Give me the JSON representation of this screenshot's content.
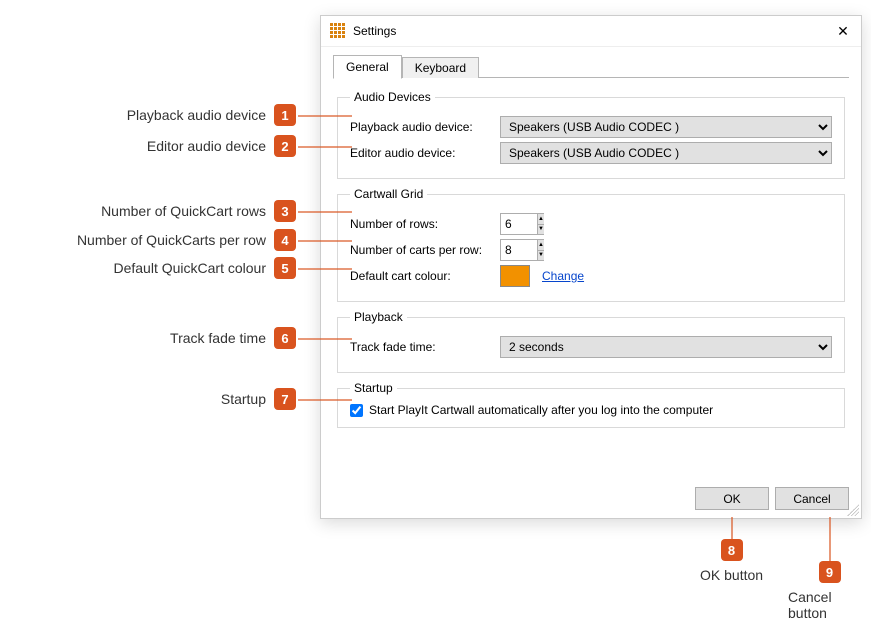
{
  "window": {
    "title": "Settings"
  },
  "tabs": {
    "general": "General",
    "keyboard": "Keyboard"
  },
  "audio": {
    "legend": "Audio Devices",
    "playback_label": "Playback audio device:",
    "playback_value": "Speakers (USB Audio CODEC )",
    "editor_label": "Editor audio device:",
    "editor_value": "Speakers (USB Audio CODEC )"
  },
  "grid": {
    "legend": "Cartwall Grid",
    "rows_label": "Number of rows:",
    "rows_value": "6",
    "perrow_label": "Number of carts per row:",
    "perrow_value": "8",
    "color_label": "Default cart colour:",
    "color_value": "#f29100",
    "change_link": "Change"
  },
  "playback": {
    "legend": "Playback",
    "fade_label": "Track fade time:",
    "fade_value": "2 seconds"
  },
  "startup": {
    "legend": "Startup",
    "checkbox_label": "Start PlayIt Cartwall automatically after you log into the computer",
    "checked": true
  },
  "buttons": {
    "ok": "OK",
    "cancel": "Cancel"
  },
  "callouts": {
    "1": "Playback audio device",
    "2": "Editor audio device",
    "3": "Number of QuickCart rows",
    "4": "Number of QuickCarts per row",
    "5": "Default QuickCart colour",
    "6": "Track fade time",
    "7": "Startup",
    "8": "OK button",
    "9": "Cancel button"
  }
}
